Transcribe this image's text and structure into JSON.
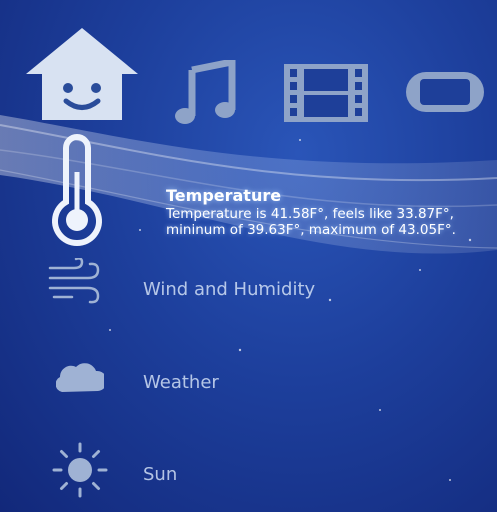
{
  "top_nav": {
    "items": [
      {
        "name": "home",
        "icon": "home-face-icon"
      },
      {
        "name": "music",
        "icon": "music-note-icon"
      },
      {
        "name": "video",
        "icon": "film-strip-icon"
      },
      {
        "name": "game",
        "icon": "psp-console-icon"
      }
    ]
  },
  "selected": {
    "icon": "thermometer-icon",
    "title": "Temperature",
    "description": "Temperature is 41.58F°, feels like 33.87F°, mininum of 39.63F°, maximum of 43.05F°."
  },
  "menu": {
    "items": [
      {
        "label": "Wind and Humidity",
        "icon": "wind-icon"
      },
      {
        "label": "Weather",
        "icon": "cloud-icon"
      },
      {
        "label": "Sun",
        "icon": "sun-icon"
      }
    ]
  },
  "colors": {
    "background": "#1d3f9c",
    "icon_active": "#d8e2f2",
    "icon_inactive": "#8ea3c8"
  }
}
